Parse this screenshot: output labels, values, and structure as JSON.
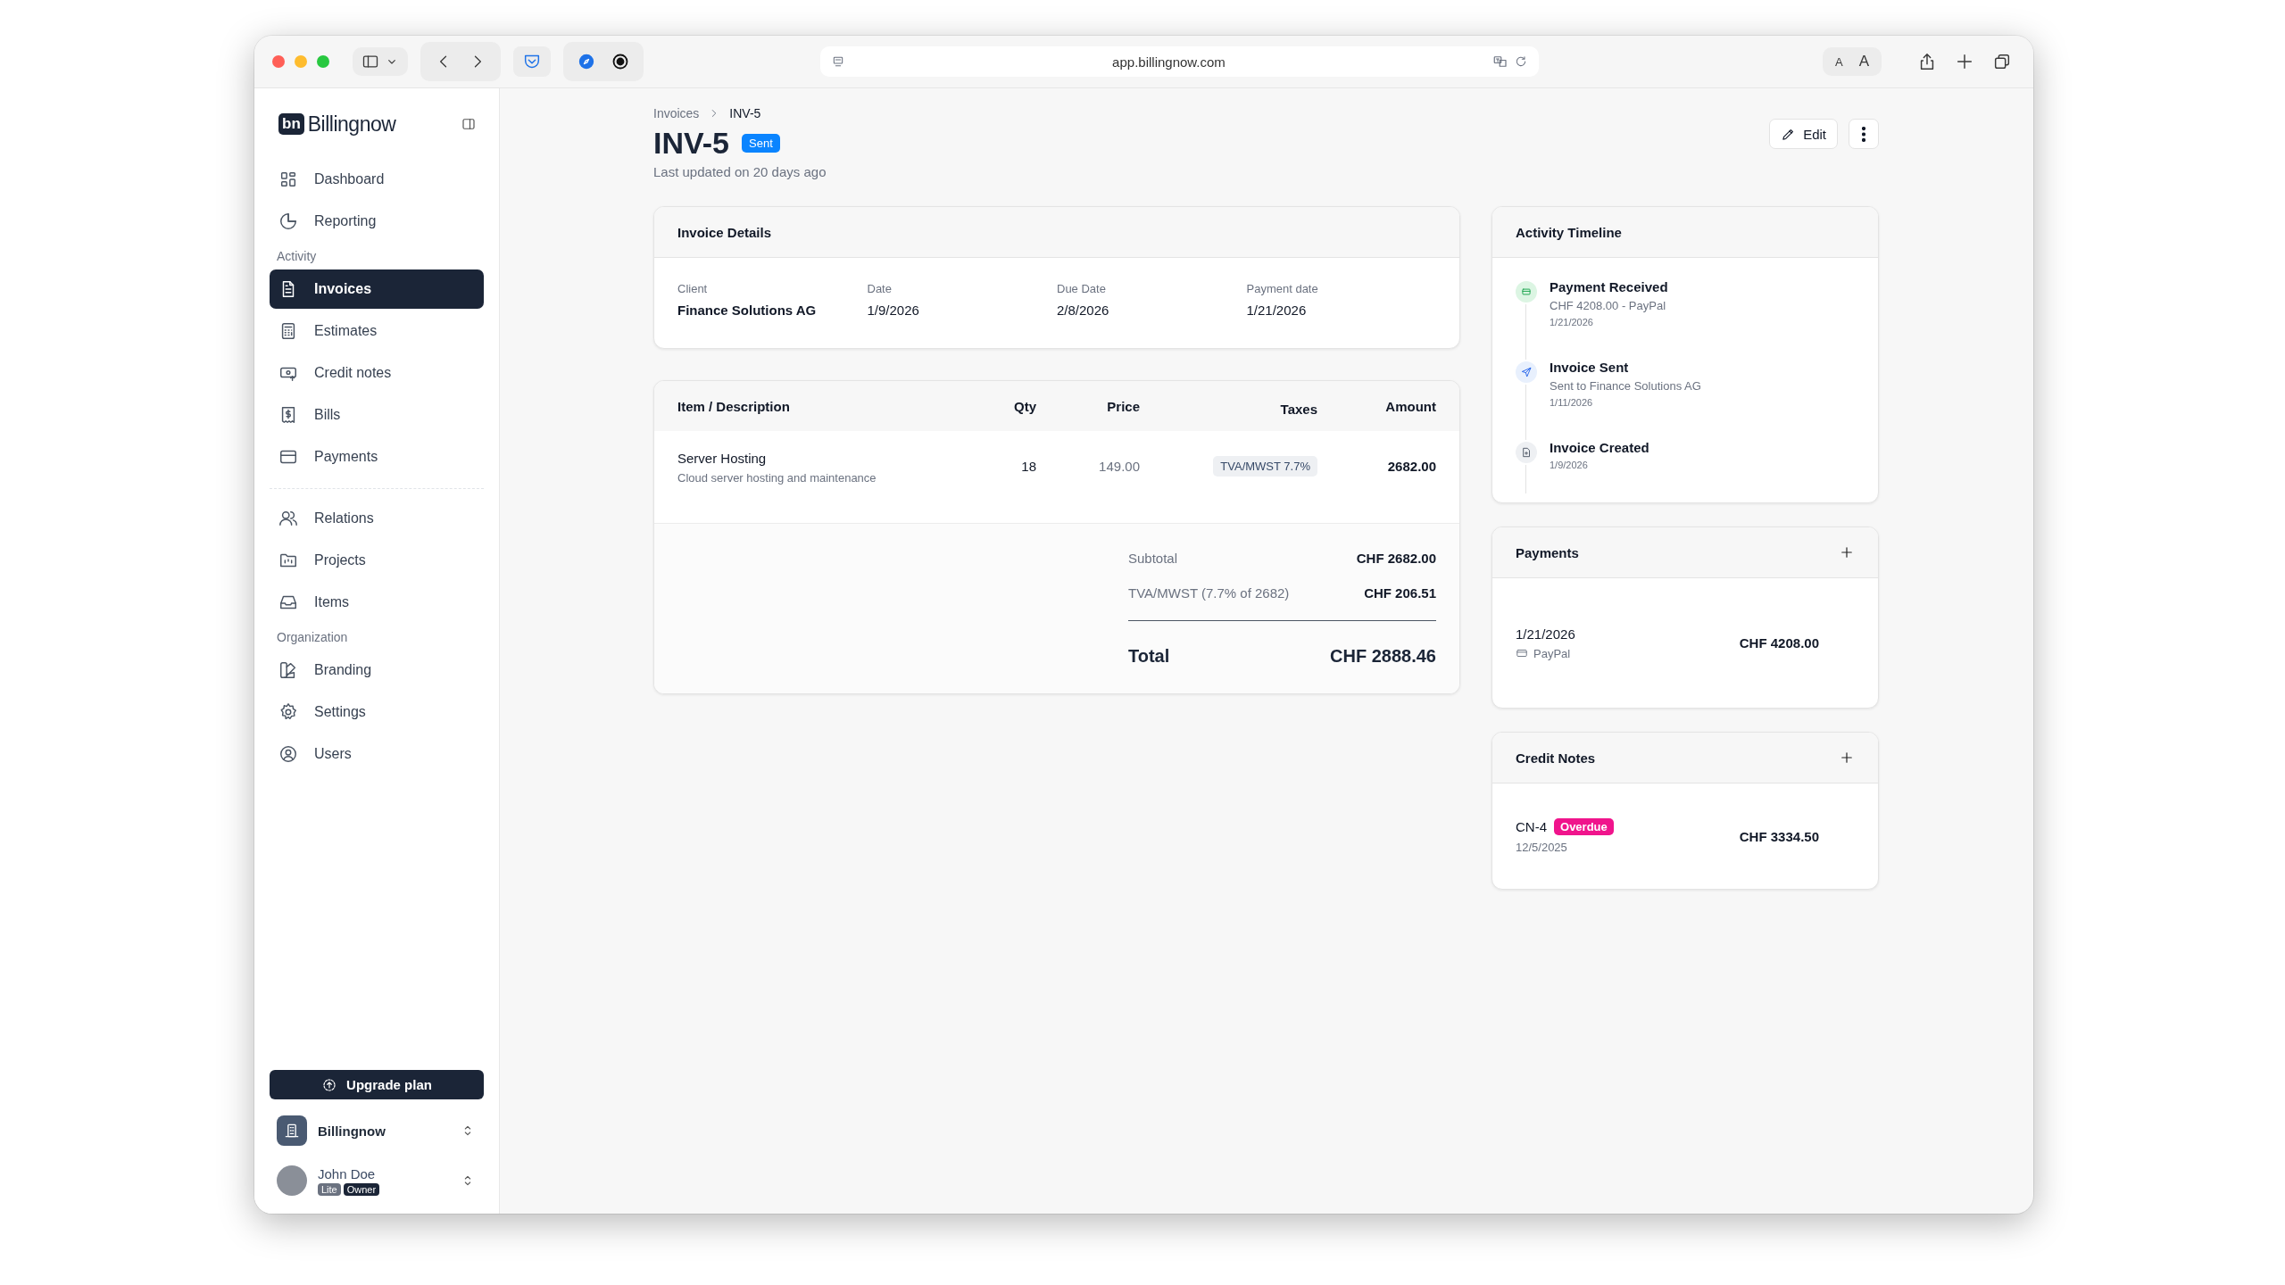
{
  "browser": {
    "url": "app.billingnow.com",
    "text_size_buttons": [
      "A",
      "A"
    ]
  },
  "sidebar": {
    "brand": {
      "mark": "bn",
      "name": "Billingnow"
    },
    "nav": [
      {
        "kind": "link",
        "label": "Dashboard",
        "selected": false
      },
      {
        "kind": "link",
        "label": "Reporting",
        "selected": false
      },
      {
        "kind": "heading",
        "label": "Activity"
      },
      {
        "kind": "link",
        "label": "Invoices",
        "selected": true
      },
      {
        "kind": "link",
        "label": "Estimates",
        "selected": false
      },
      {
        "kind": "link",
        "label": "Credit notes",
        "selected": false
      },
      {
        "kind": "link",
        "label": "Bills",
        "selected": false
      },
      {
        "kind": "link",
        "label": "Payments",
        "selected": false
      },
      {
        "kind": "divider"
      },
      {
        "kind": "link",
        "label": "Relations",
        "selected": false
      },
      {
        "kind": "link",
        "label": "Projects",
        "selected": false
      },
      {
        "kind": "link",
        "label": "Items",
        "selected": false
      },
      {
        "kind": "heading",
        "label": "Organization"
      },
      {
        "kind": "link",
        "label": "Branding",
        "selected": false
      },
      {
        "kind": "link",
        "label": "Settings",
        "selected": false
      },
      {
        "kind": "link",
        "label": "Users",
        "selected": false
      }
    ],
    "upgrade_button": "Upgrade plan",
    "workspace": {
      "name": "Billingnow"
    },
    "user": {
      "name": "John Doe",
      "badges": [
        "Lite",
        "Owner"
      ]
    }
  },
  "header": {
    "breadcrumb": [
      "Invoices",
      "INV-5"
    ],
    "title": "INV-5",
    "status": {
      "label": "Sent",
      "color": "#0a84ff"
    },
    "updated": "Last updated on 20 days ago",
    "edit_button": "Edit"
  },
  "invoice_details": {
    "title": "Invoice Details",
    "fields": [
      {
        "label": "Client",
        "value": "Finance Solutions AG"
      },
      {
        "label": "Date",
        "value": "1/9/2026"
      },
      {
        "label": "Due Date",
        "value": "2/8/2026"
      },
      {
        "label": "Payment date",
        "value": "1/21/2026"
      }
    ]
  },
  "items_table": {
    "columns": [
      "Item / Description",
      "Qty",
      "Price",
      "Taxes",
      "Amount"
    ],
    "rows": [
      {
        "name": "Server Hosting",
        "description": "Cloud server hosting and maintenance",
        "qty": "18",
        "price": "149.00",
        "tax": "TVA/MWST 7.7%",
        "amount": "2682.00"
      }
    ],
    "totals": [
      {
        "label": "Subtotal",
        "value": "CHF 2682.00"
      },
      {
        "label": "TVA/MWST (7.7% of 2682)",
        "value": "CHF 206.51"
      }
    ],
    "total": {
      "label": "Total",
      "value": "CHF 2888.46"
    }
  },
  "activity": {
    "title": "Activity Timeline",
    "events": [
      {
        "kind": "payment",
        "title": "Payment Received",
        "detail": "CHF 4208.00 - PayPal",
        "date": "1/21/2026"
      },
      {
        "kind": "sent",
        "title": "Invoice Sent",
        "detail": "Sent to Finance Solutions AG",
        "date": "1/11/2026"
      },
      {
        "kind": "created",
        "title": "Invoice Created",
        "date": "1/9/2026"
      }
    ]
  },
  "payments": {
    "title": "Payments",
    "items": [
      {
        "date": "1/21/2026",
        "method": "PayPal",
        "amount": "CHF 4208.00"
      }
    ]
  },
  "credit_notes": {
    "title": "Credit Notes",
    "items": [
      {
        "number": "CN-4",
        "status": {
          "label": "Overdue",
          "color": "#f0148c"
        },
        "date": "12/5/2025",
        "amount": "CHF 3334.50"
      }
    ]
  }
}
